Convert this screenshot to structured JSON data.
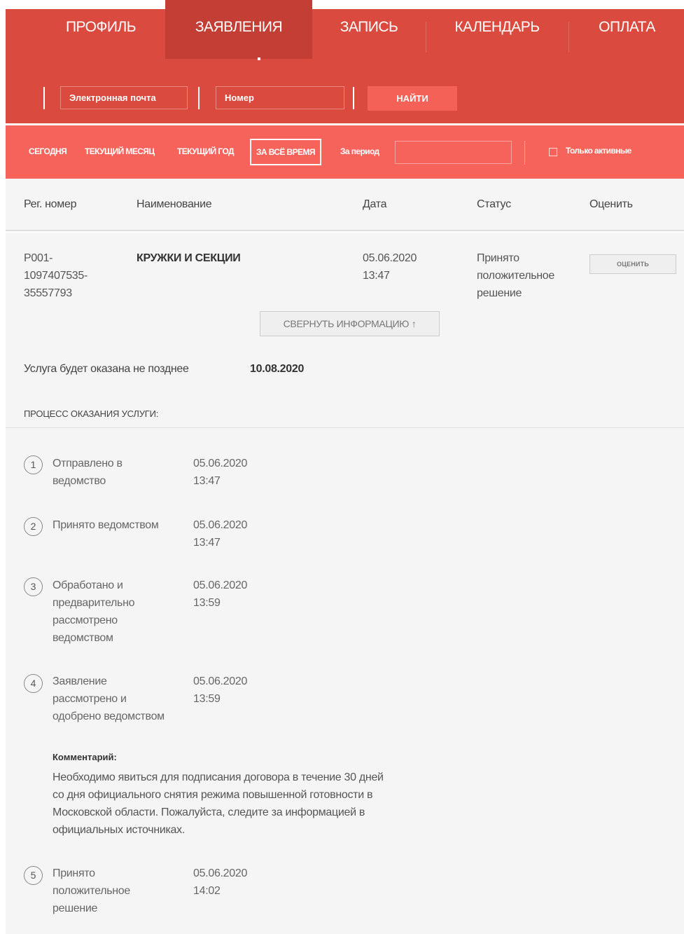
{
  "nav": {
    "items": [
      {
        "label": "ПРОФИЛЬ"
      },
      {
        "label": "ЗАЯВЛЕНИЯ"
      },
      {
        "label": "ЗАПИСЬ"
      },
      {
        "label": "КАЛЕНДАРЬ"
      },
      {
        "label": "ОПЛАТА"
      }
    ],
    "active_index": 1
  },
  "search": {
    "email_placeholder": "Электронная почта",
    "number_placeholder": "Номер",
    "find_label": "НАЙТИ"
  },
  "filters": {
    "items": [
      {
        "label": "СЕГОДНЯ"
      },
      {
        "label": "ТЕКУЩИЙ МЕСЯЦ"
      },
      {
        "label": "ТЕКУЩИЙ ГОД"
      },
      {
        "label": "ЗА ВСЁ ВРЕМЯ"
      }
    ],
    "active_label": "ЗА ВСЁ ВРЕМЯ",
    "period_label": "За период",
    "period_value": "",
    "only_active_label": "Только активные",
    "only_active_checked": false
  },
  "table": {
    "columns": [
      "Рег. номер",
      "Наименование",
      "Дата",
      "Статус",
      "Оценить"
    ],
    "row": {
      "reg_number_lines": [
        "P001-",
        "1097407535-",
        "35557793"
      ],
      "name": "КРУЖКИ И СЕКЦИИ",
      "date_lines": [
        "05.06.2020",
        "13:47"
      ],
      "status_lines": [
        "Принято",
        "положительное",
        "решение"
      ],
      "rate_label": "ОЦЕНИТЬ"
    }
  },
  "details": {
    "collapse_label": "СВЕРНУТЬ ИНФОРМАЦИЮ ↑",
    "deadline_label": "Услуга будет оказана не позднее",
    "deadline_date": "10.08.2020",
    "process_title": "ПРОЦЕСС ОКАЗАНИЯ УСЛУГИ:",
    "steps": [
      {
        "num": "1",
        "label_lines": [
          "Отправлено в",
          "ведомство"
        ],
        "date_lines": [
          "05.06.2020",
          "13:47"
        ]
      },
      {
        "num": "2",
        "label_lines": [
          "Принято ведомством"
        ],
        "date_lines": [
          "05.06.2020",
          "13:47"
        ]
      },
      {
        "num": "3",
        "label_lines": [
          "Обработано и",
          "предварительно",
          "рассмотрено",
          "ведомством"
        ],
        "date_lines": [
          "05.06.2020",
          "13:59"
        ]
      },
      {
        "num": "4",
        "label_lines": [
          "Заявление",
          "рассмотрено и",
          "одобрено ведомством"
        ],
        "date_lines": [
          "05.06.2020",
          "13:59"
        ]
      },
      {
        "num": "5",
        "label_lines": [
          "Принято",
          "положительное",
          "решение"
        ],
        "date_lines": [
          "05.06.2020",
          "14:02"
        ]
      }
    ],
    "comment_head": "Комментарий:",
    "comment_lines": [
      "Необходимо явиться для подписания договора в течение 30 дней",
      "со дня официального снятия режима повышенной готовности в",
      "Московской области. Пожалуйста, следите за информацией в",
      "официальных источниках."
    ]
  },
  "colors": {
    "header_red": "#da4a3e",
    "active_tab": "#c33f35",
    "filter_red": "#f6635a",
    "button_red": "#f36157"
  }
}
